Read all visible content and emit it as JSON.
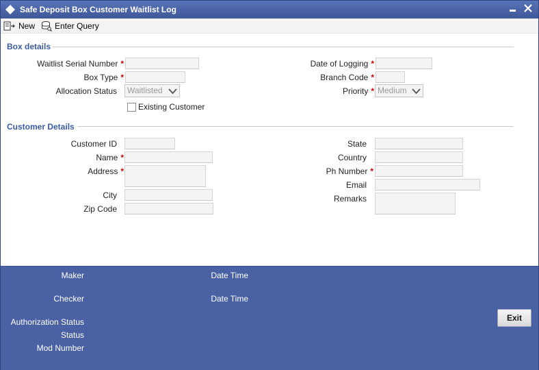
{
  "window": {
    "title": "Safe Deposit Box Customer Waitlist Log"
  },
  "toolbar": {
    "new_label": "New",
    "enter_query_label": "Enter Query"
  },
  "box_details": {
    "title": "Box details",
    "waitlist_serial_number": "Waitlist Serial Number",
    "box_type": "Box Type",
    "allocation_status": "Allocation Status",
    "allocation_status_value": "Waitlisted",
    "existing_customer": "Existing Customer",
    "date_of_logging": "Date of Logging",
    "branch_code": "Branch Code",
    "priority": "Priority",
    "priority_value": "Medium",
    "required_mark": "*"
  },
  "customer_details": {
    "title": "Customer Details",
    "customer_id": "Customer ID",
    "name": "Name",
    "address": "Address",
    "city": "City",
    "zip_code": "Zip Code",
    "state": "State",
    "country": "Country",
    "ph_number": "Ph Number",
    "email": "Email",
    "remarks": "Remarks"
  },
  "footer": {
    "maker": "Maker",
    "checker": "Checker",
    "date_time_1": "Date Time",
    "date_time_2": "Date Time",
    "authorization_status": "Authorization Status",
    "status": "Status",
    "mod_number": "Mod Number",
    "exit_label": "Exit"
  }
}
